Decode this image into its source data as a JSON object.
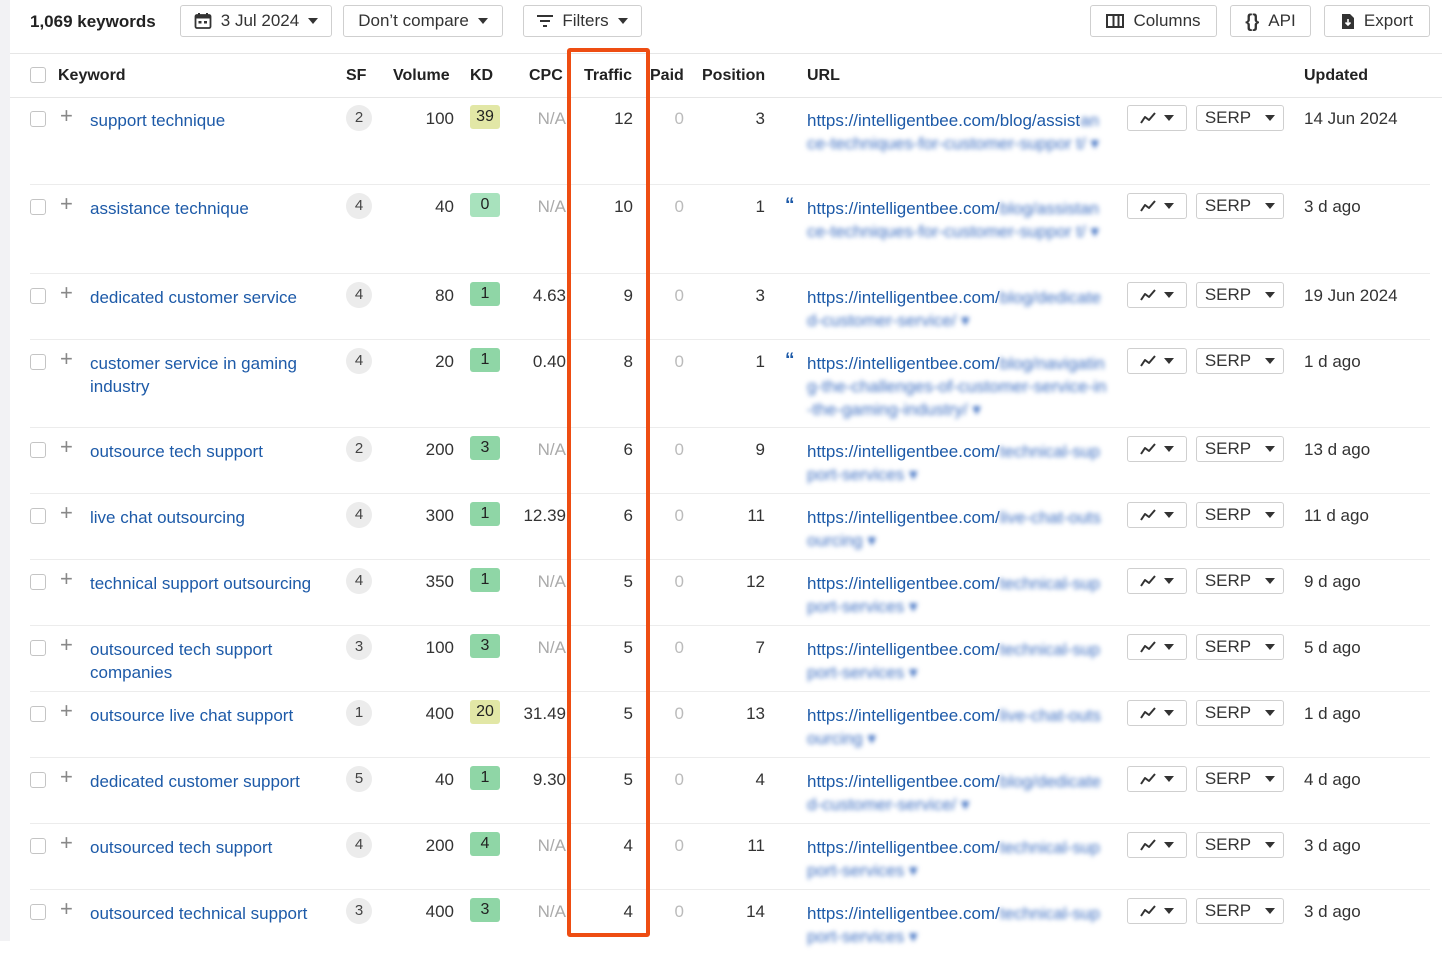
{
  "toolbar": {
    "keyword_count": "1,069 keywords",
    "date_label": "3 Jul 2024",
    "compare_label": "Don’t compare",
    "filters_label": "Filters",
    "columns_label": "Columns",
    "api_label": "API",
    "export_label": "Export"
  },
  "columns": {
    "keyword": "Keyword",
    "sf": "SF",
    "volume": "Volume",
    "kd": "KD",
    "cpc": "CPC",
    "traffic": "Traffic",
    "paid": "Paid",
    "position": "Position",
    "url": "URL",
    "updated": "Updated"
  },
  "serp_label": "SERP",
  "kd_colors": {
    "high": "#e2e7a6",
    "low": "#8fd6a6",
    "lowest": "#a8e2bd"
  },
  "highlight_color": "#ee4d12",
  "rows": [
    {
      "keyword": "support technique",
      "sf": "2",
      "volume": "100",
      "kd": "39",
      "cpc": "N/A",
      "traffic": "12",
      "paid": "0",
      "position": "3",
      "quote": false,
      "url": "https://intelligentbee.com/blog/assist",
      "url_blur": "ance-techniques-for-customer-suppor t/ ▾",
      "updated": "14 Jun 2024"
    },
    {
      "keyword": "assistance technique",
      "sf": "4",
      "volume": "40",
      "kd": "0",
      "cpc": "N/A",
      "traffic": "10",
      "paid": "0",
      "position": "1",
      "quote": true,
      "url": "https://intelligentbee.com/",
      "url_blur": "blog/assistance-techniques-for-customer-suppor t/ ▾",
      "updated": "3 d ago"
    },
    {
      "keyword": "dedicated customer service",
      "sf": "4",
      "volume": "80",
      "kd": "1",
      "cpc": "4.63",
      "traffic": "9",
      "paid": "0",
      "position": "3",
      "quote": false,
      "url": "https://intelligentbee.com/",
      "url_blur": "blog/dedicated-customer-service/ ▾",
      "updated": "19 Jun 2024"
    },
    {
      "keyword": "customer service in gaming industry",
      "sf": "4",
      "volume": "20",
      "kd": "1",
      "cpc": "0.40",
      "traffic": "8",
      "paid": "0",
      "position": "1",
      "quote": true,
      "url": "https://intelligentbee.com/",
      "url_blur": "blog/navigating-the-challenges-of-customer-service-in-the-gaming-industry/ ▾",
      "updated": "1 d ago"
    },
    {
      "keyword": "outsource tech support",
      "sf": "2",
      "volume": "200",
      "kd": "3",
      "cpc": "N/A",
      "traffic": "6",
      "paid": "0",
      "position": "9",
      "quote": false,
      "url": "https://intelligentbee.com/",
      "url_blur": "technical-support-services ▾",
      "updated": "13 d ago"
    },
    {
      "keyword": "live chat outsourcing",
      "sf": "4",
      "volume": "300",
      "kd": "1",
      "cpc": "12.39",
      "traffic": "6",
      "paid": "0",
      "position": "11",
      "quote": false,
      "url": "https://intelligentbee.com/",
      "url_blur": "live-chat-outsourcing ▾",
      "updated": "11 d ago"
    },
    {
      "keyword": "technical support outsourcing",
      "sf": "4",
      "volume": "350",
      "kd": "1",
      "cpc": "N/A",
      "traffic": "5",
      "paid": "0",
      "position": "12",
      "quote": false,
      "url": "https://intelligentbee.com/",
      "url_blur": "technical-support-services ▾",
      "updated": "9 d ago"
    },
    {
      "keyword": "outsourced tech support companies",
      "sf": "3",
      "volume": "100",
      "kd": "3",
      "cpc": "N/A",
      "traffic": "5",
      "paid": "0",
      "position": "7",
      "quote": false,
      "url": "https://intelligentbee.com/",
      "url_blur": "technical-support-services ▾",
      "updated": "5 d ago"
    },
    {
      "keyword": "outsource live chat support",
      "sf": "1",
      "volume": "400",
      "kd": "20",
      "cpc": "31.49",
      "traffic": "5",
      "paid": "0",
      "position": "13",
      "quote": false,
      "url": "https://intelligentbee.com/",
      "url_blur": "live-chat-outsourcing ▾",
      "updated": "1 d ago"
    },
    {
      "keyword": "dedicated customer support",
      "sf": "5",
      "volume": "40",
      "kd": "1",
      "cpc": "9.30",
      "traffic": "5",
      "paid": "0",
      "position": "4",
      "quote": false,
      "url": "https://intelligentbee.com/",
      "url_blur": "blog/dedicated-customer-service/ ▾",
      "updated": "4 d ago"
    },
    {
      "keyword": "outsourced tech support",
      "sf": "4",
      "volume": "200",
      "kd": "4",
      "cpc": "N/A",
      "traffic": "4",
      "paid": "0",
      "position": "11",
      "quote": false,
      "url": "https://intelligentbee.com/",
      "url_blur": "technical-support-services ▾",
      "updated": "3 d ago"
    },
    {
      "keyword": "outsourced technical support",
      "sf": "3",
      "volume": "400",
      "kd": "3",
      "cpc": "N/A",
      "traffic": "4",
      "paid": "0",
      "position": "14",
      "quote": false,
      "url": "https://intelligentbee.com/",
      "url_blur": "technical-support-services ▾",
      "updated": "3 d ago"
    }
  ]
}
